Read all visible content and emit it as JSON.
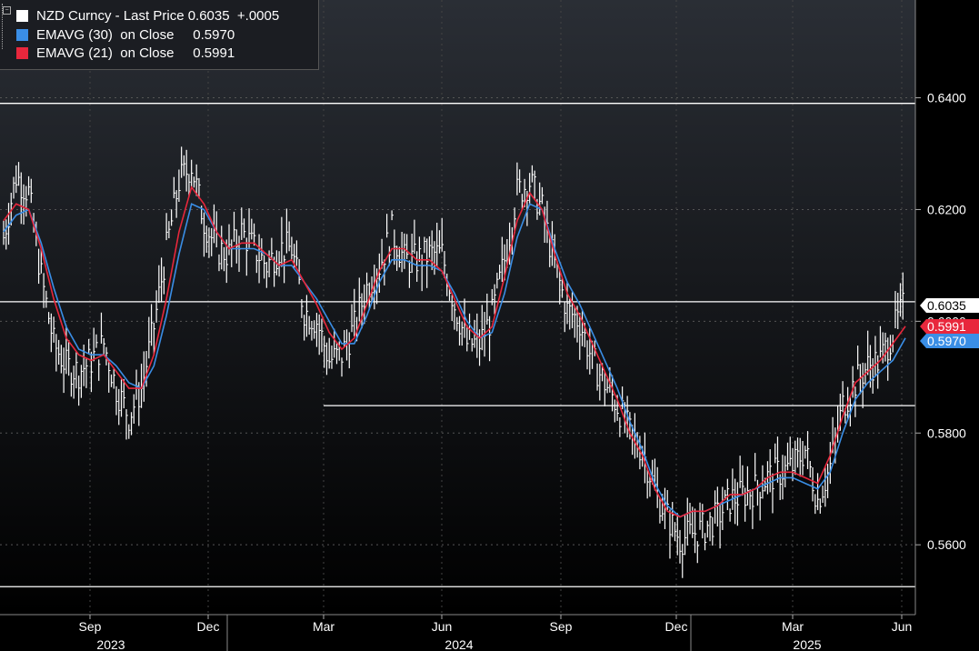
{
  "legend": {
    "main": "NZD Curncy - Last Price 0.6035  +.0005",
    "ema30": "EMAVG (30)  on Close     0.5970",
    "ema21": "EMAVG (21)  on Close     0.5991",
    "colors": {
      "price": "#ffffff",
      "ema30": "#3a8ee6",
      "ema21": "#e8273c"
    }
  },
  "chart_data": {
    "type": "bar",
    "title": "NZD Curncy",
    "ylim": [
      0.5475,
      0.6575
    ],
    "y_ticks": [
      "0.5600",
      "0.5800",
      "0.6000",
      "0.6200",
      "0.6400"
    ],
    "x_ticks": [
      "Sep",
      "Dec",
      "Mar",
      "Jun",
      "Sep",
      "Dec",
      "Mar",
      "Jun"
    ],
    "year_labels": [
      "2023",
      "2024",
      "2025"
    ],
    "last_price_label": "0.6035",
    "ema21_label": "0.5991",
    "ema30_label": "0.5970",
    "horizontal_lines": [
      {
        "y": 0.639,
        "from": "start"
      },
      {
        "y": 0.6035,
        "from": "start"
      },
      {
        "y": 0.5849,
        "from": "Mar"
      },
      {
        "y": 0.5525,
        "from": "start"
      }
    ],
    "grid": true,
    "legend_position": "top-left",
    "series": [
      {
        "key": "price",
        "values": [
          0.615,
          0.626,
          0.623,
          0.608,
          0.596,
          0.592,
          0.591,
          0.593,
          0.596,
          0.588,
          0.583,
          0.588,
          0.599,
          0.613,
          0.625,
          0.628,
          0.618,
          0.613,
          0.612,
          0.616,
          0.613,
          0.61,
          0.613,
          0.613,
          0.602,
          0.6,
          0.593,
          0.594,
          0.599,
          0.606,
          0.61,
          0.616,
          0.611,
          0.611,
          0.612,
          0.612,
          0.603,
          0.596,
          0.596,
          0.601,
          0.611,
          0.623,
          0.625,
          0.62,
          0.61,
          0.602,
          0.6,
          0.593,
          0.589,
          0.585,
          0.58,
          0.577,
          0.57,
          0.565,
          0.561,
          0.562,
          0.563,
          0.565,
          0.568,
          0.569,
          0.57,
          0.572,
          0.573,
          0.574,
          0.577,
          0.568,
          0.574,
          0.585,
          0.589,
          0.592,
          0.593,
          0.598,
          0.6035
        ]
      },
      {
        "key": "ema21",
        "name": "EMAVG (21)",
        "values": [
          0.618,
          0.621,
          0.62,
          0.613,
          0.604,
          0.597,
          0.594,
          0.593,
          0.594,
          0.591,
          0.588,
          0.588,
          0.594,
          0.604,
          0.616,
          0.624,
          0.621,
          0.616,
          0.613,
          0.614,
          0.614,
          0.612,
          0.61,
          0.611,
          0.607,
          0.603,
          0.598,
          0.595,
          0.597,
          0.603,
          0.609,
          0.613,
          0.613,
          0.611,
          0.611,
          0.609,
          0.604,
          0.599,
          0.597,
          0.599,
          0.608,
          0.618,
          0.623,
          0.62,
          0.612,
          0.605,
          0.601,
          0.596,
          0.591,
          0.586,
          0.58,
          0.576,
          0.57,
          0.566,
          0.565,
          0.566,
          0.566,
          0.567,
          0.569,
          0.569,
          0.57,
          0.572,
          0.573,
          0.573,
          0.572,
          0.571,
          0.576,
          0.583,
          0.589,
          0.591,
          0.593,
          0.596,
          0.5991
        ]
      },
      {
        "key": "ema30",
        "name": "EMAVG (30)",
        "values": [
          0.616,
          0.619,
          0.62,
          0.614,
          0.606,
          0.599,
          0.595,
          0.594,
          0.594,
          0.592,
          0.589,
          0.588,
          0.592,
          0.601,
          0.612,
          0.621,
          0.62,
          0.616,
          0.613,
          0.613,
          0.613,
          0.612,
          0.61,
          0.61,
          0.607,
          0.604,
          0.6,
          0.596,
          0.596,
          0.601,
          0.607,
          0.611,
          0.611,
          0.61,
          0.61,
          0.609,
          0.605,
          0.6,
          0.597,
          0.598,
          0.605,
          0.615,
          0.621,
          0.62,
          0.613,
          0.607,
          0.603,
          0.598,
          0.593,
          0.588,
          0.582,
          0.577,
          0.571,
          0.567,
          0.565,
          0.566,
          0.566,
          0.567,
          0.568,
          0.569,
          0.57,
          0.571,
          0.572,
          0.572,
          0.571,
          0.57,
          0.573,
          0.58,
          0.586,
          0.589,
          0.591,
          0.593,
          0.597
        ]
      }
    ]
  }
}
